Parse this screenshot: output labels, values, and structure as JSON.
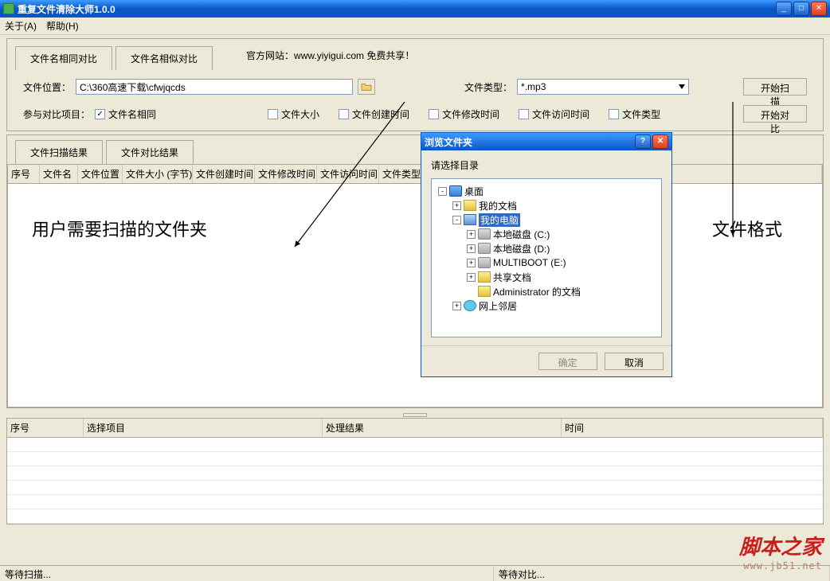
{
  "window": {
    "title": "重复文件清除大师1.0.0"
  },
  "menu": {
    "about": "关于(A)",
    "help": "帮助(H)"
  },
  "topTabs": {
    "tab1": "文件名相同对比",
    "tab2": "文件名相似对比",
    "official": "官方网站：www.yiyigui.com 免费共享！"
  },
  "form": {
    "locationLabel": "文件位置：",
    "locationValue": "C:\\360高速下载\\cfwjqcds",
    "typeLabel": "文件类型：",
    "typeValue": "*.mp3",
    "scanBtn": "开始扫描",
    "compareBtn": "开始对比",
    "compareItemsLabel": "参与对比项目：",
    "chk_name": "文件名相同",
    "chk_size": "文件大小",
    "chk_ctime": "文件创建时间",
    "chk_mtime": "文件修改时间",
    "chk_atime": "文件访问时间",
    "chk_type": "文件类型"
  },
  "resultTabs": {
    "tab1": "文件扫描结果",
    "tab2": "文件对比结果"
  },
  "columns": [
    "序号",
    "文件名",
    "文件位置",
    "文件大小 (字节)",
    "文件创建时间",
    "文件修改时间",
    "文件访问时间",
    "文件类型"
  ],
  "annotations": {
    "left": "用户需要扫描的文件夹",
    "right": "文件格式"
  },
  "lowerColumns": {
    "c1": "序号",
    "c2": "选择项目",
    "c3": "处理结果",
    "c4": "时间"
  },
  "status": {
    "left": "等待扫描...",
    "right": "等待对比..."
  },
  "dialog": {
    "title": "浏览文件夹",
    "instruction": "请选择目录",
    "tree": {
      "desktop": "桌面",
      "mydocs": "我的文档",
      "mycomputer": "我的电脑",
      "diskC": "本地磁盘 (C:)",
      "diskD": "本地磁盘 (D:)",
      "multiboot": "MULTIBOOT (E:)",
      "shared": "共享文档",
      "admindoc": "Administrator 的文档",
      "network": "网上邻居"
    },
    "ok": "确定",
    "cancel": "取消"
  },
  "watermark": {
    "line1": "脚本之家",
    "line2": "www.jb51.net"
  }
}
